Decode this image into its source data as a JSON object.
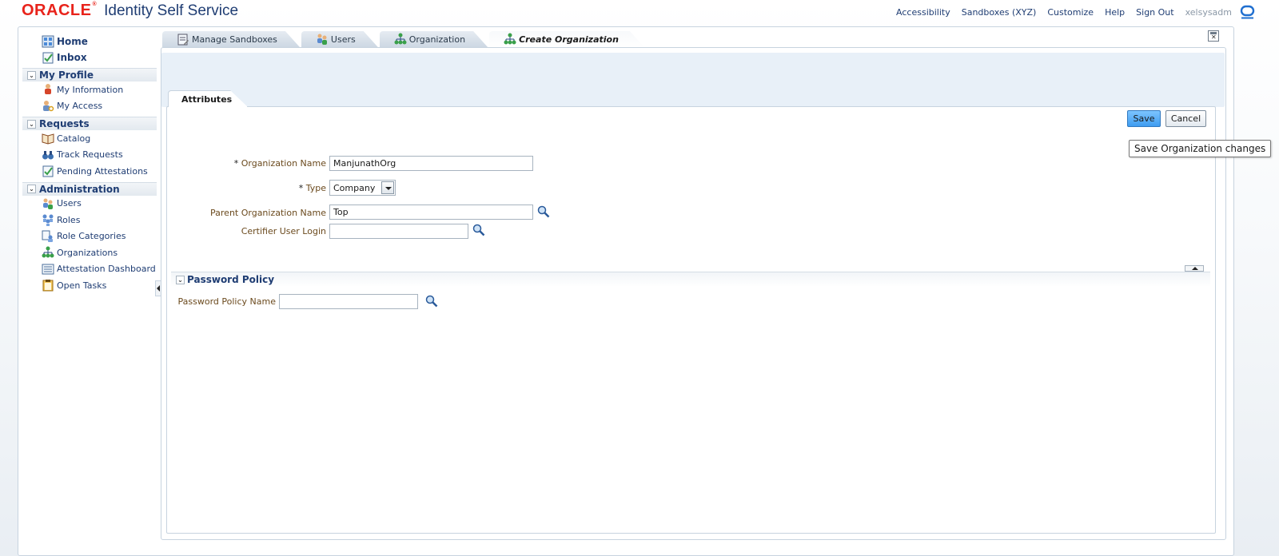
{
  "header": {
    "logo_text": "ORACLE",
    "app_title": "Identity Self Service",
    "links": [
      "Accessibility",
      "Sandboxes (XYZ)",
      "Customize",
      "Help",
      "Sign Out"
    ],
    "username": "xelsysadm"
  },
  "sidebar": {
    "top_items": [
      {
        "label": "Home",
        "icon": "home-icon"
      },
      {
        "label": "Inbox",
        "icon": "inbox-icon"
      }
    ],
    "sections": [
      {
        "title": "My Profile",
        "items": [
          {
            "label": "My Information",
            "icon": "person-icon"
          },
          {
            "label": "My Access",
            "icon": "key-user-icon"
          }
        ]
      },
      {
        "title": "Requests",
        "items": [
          {
            "label": "Catalog",
            "icon": "book-icon"
          },
          {
            "label": "Track Requests",
            "icon": "binoculars-icon"
          },
          {
            "label": "Pending Attestations",
            "icon": "checklist-icon"
          }
        ]
      },
      {
        "title": "Administration",
        "items": [
          {
            "label": "Users",
            "icon": "users-icon"
          },
          {
            "label": "Roles",
            "icon": "roles-icon"
          },
          {
            "label": "Role Categories",
            "icon": "role-categories-icon"
          },
          {
            "label": "Organizations",
            "icon": "organization-icon"
          },
          {
            "label": "Attestation Dashboard",
            "icon": "dashboard-icon"
          },
          {
            "label": "Open Tasks",
            "icon": "clipboard-icon"
          }
        ]
      }
    ]
  },
  "tabs": [
    {
      "label": "Manage Sandboxes",
      "icon": "sandbox-icon"
    },
    {
      "label": "Users",
      "icon": "users-icon"
    },
    {
      "label": "Organization",
      "icon": "organization-icon"
    },
    {
      "label": "Create Organization",
      "icon": "organization-icon",
      "active": true
    }
  ],
  "form": {
    "subtab": "Attributes",
    "save_label": "Save",
    "cancel_label": "Cancel",
    "save_tooltip": "Save Organization changes",
    "org_name_label": "Organization Name",
    "org_name_value": "ManjunathOrg",
    "type_label": "Type",
    "type_value": "Company",
    "parent_label": "Parent Organization Name",
    "parent_value": "Top",
    "certifier_label": "Certifier User Login",
    "certifier_value": "",
    "required_marker": "*"
  },
  "password_policy": {
    "title": "Password Policy",
    "name_label": "Password Policy Name",
    "name_value": ""
  },
  "colors": {
    "brand_red": "#e8231b",
    "link_blue": "#1f3d73",
    "label_brown": "#6b4a1e",
    "save_blue": "#3e9cf0"
  }
}
